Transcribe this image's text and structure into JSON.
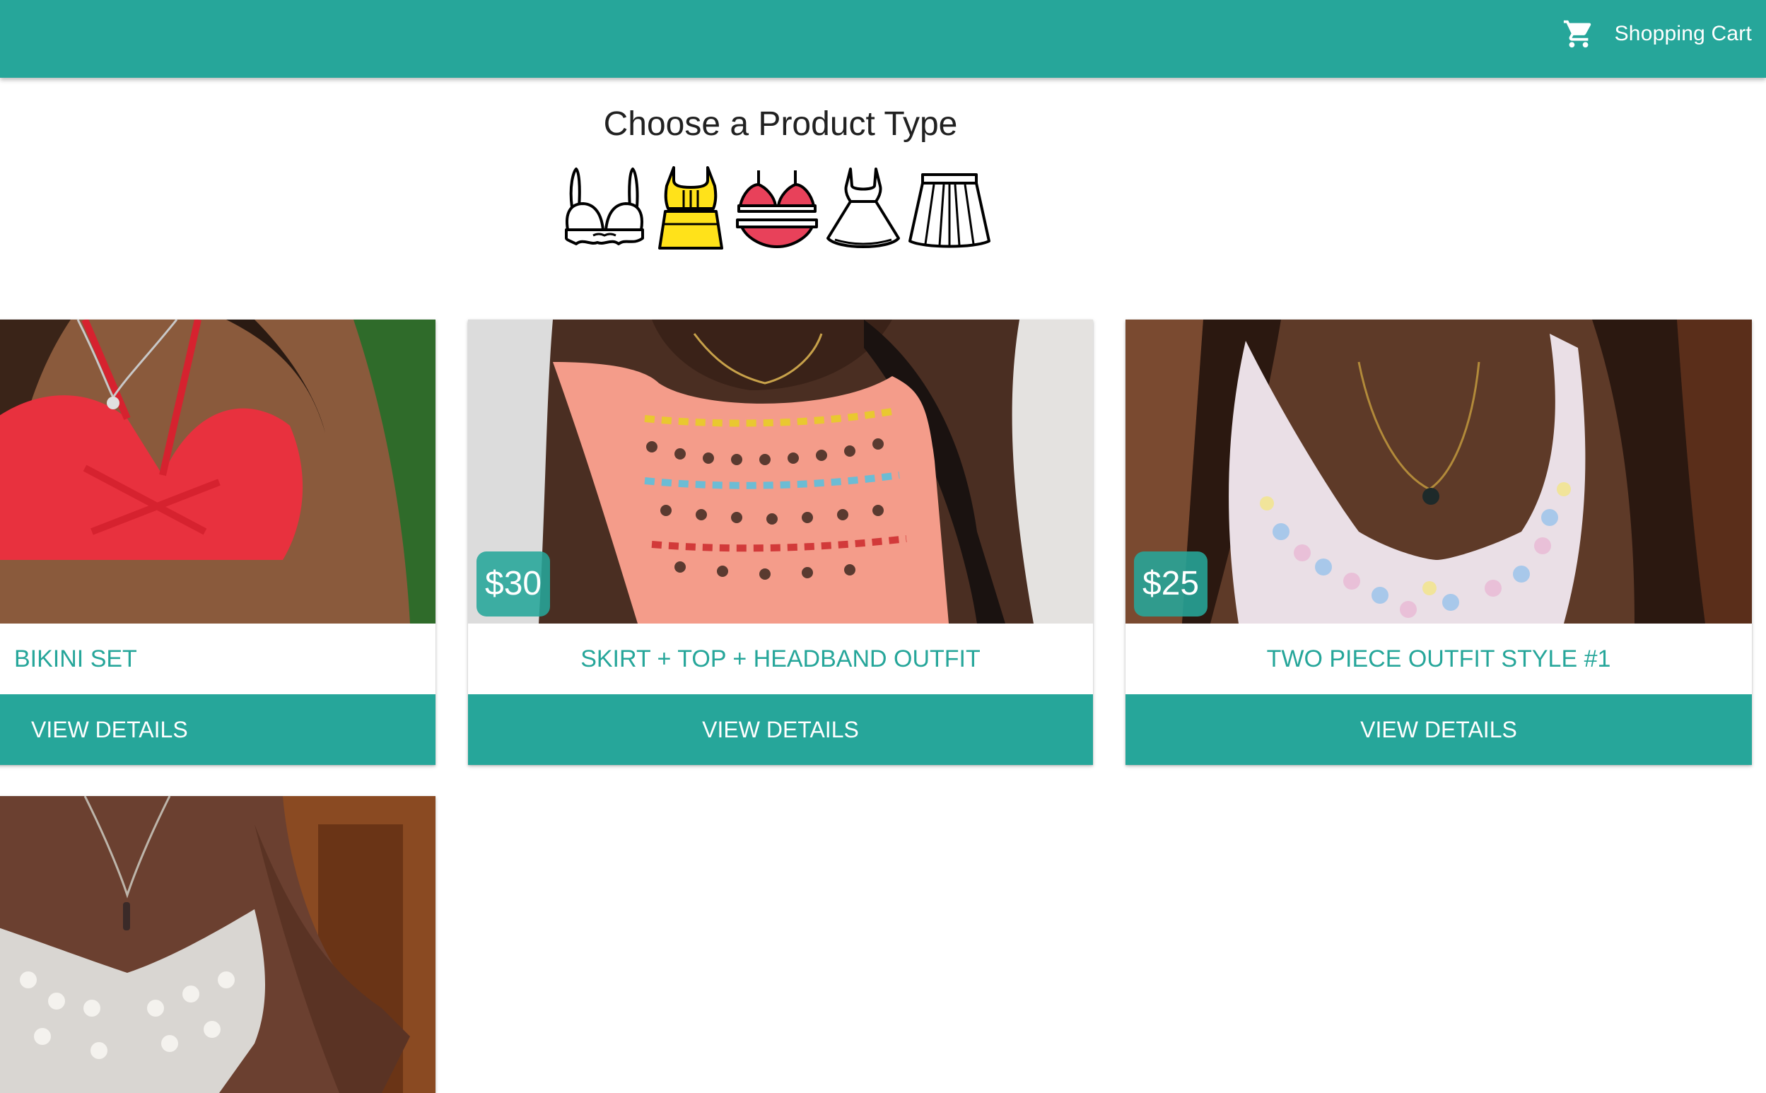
{
  "header": {
    "cart_icon": "shopping-cart-icon",
    "cart_label": "Shopping Cart",
    "brand_color": "#26a69a"
  },
  "main": {
    "heading": "Choose a Product Type",
    "product_types": [
      {
        "icon": "bra-icon",
        "color": "#ffffff"
      },
      {
        "icon": "crop-top-skirt-icon",
        "color": "#ffe21a"
      },
      {
        "icon": "bikini-icon",
        "color": "#e8415a"
      },
      {
        "icon": "dress-icon",
        "color": "#ffffff"
      },
      {
        "icon": "skirt-icon",
        "color": "#ffffff"
      }
    ]
  },
  "products": [
    {
      "title": "BIKINI SET",
      "price": "",
      "action": "VIEW DETAILS",
      "image": "red-crochet-bikini-top-photo"
    },
    {
      "title": "SKIRT + TOP + HEADBAND OUTFIT",
      "price": "$30",
      "action": "VIEW DETAILS",
      "image": "peach-granny-square-top-photo"
    },
    {
      "title": "TWO PIECE OUTFIT STYLE #1",
      "price": "$25",
      "action": "VIEW DETAILS",
      "image": "pastel-crochet-halter-top-photo"
    },
    {
      "title": "",
      "price": "",
      "action": "",
      "image": "white-crochet-top-photo"
    }
  ]
}
